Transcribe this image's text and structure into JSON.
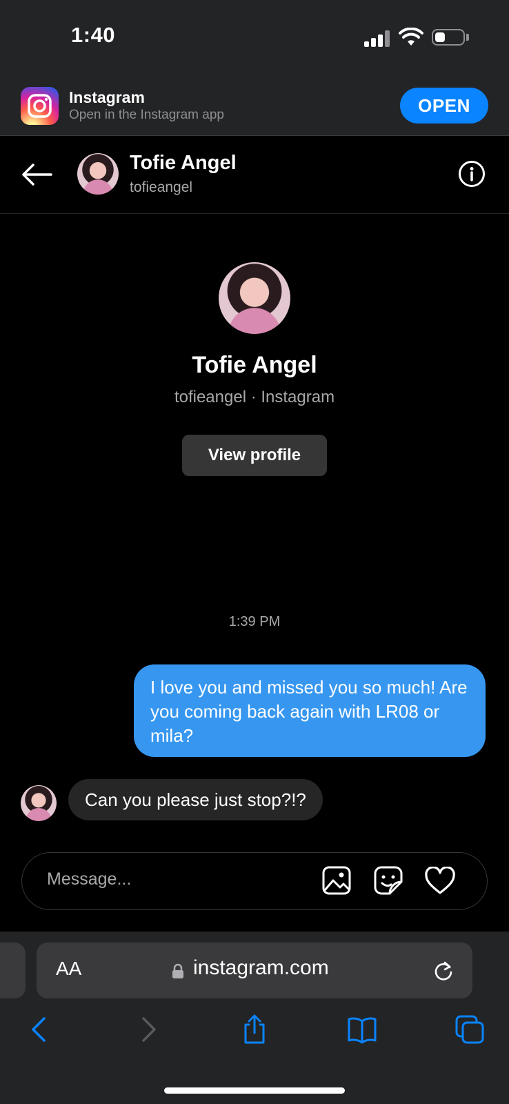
{
  "status_bar": {
    "time": "1:40"
  },
  "app_banner": {
    "title": "Instagram",
    "subtitle": "Open in the Instagram app",
    "open_label": "OPEN",
    "icon": "instagram-logo"
  },
  "chat_header": {
    "name": "Tofie Angel",
    "username": "tofieangel"
  },
  "profile_card": {
    "name": "Tofie Angel",
    "subtitle": "tofieangel · Instagram",
    "view_profile_label": "View profile"
  },
  "messages": {
    "timestamp": "1:39 PM",
    "items": [
      {
        "direction": "outgoing",
        "text": "I love you and missed you so much! Are you coming back again with LR08 or mila?"
      },
      {
        "direction": "incoming",
        "text": "Can you please just stop?!?"
      }
    ]
  },
  "composer": {
    "placeholder": "Message...",
    "icons": [
      "gallery-icon",
      "sticker-icon",
      "heart-icon"
    ]
  },
  "safari": {
    "text_size_label": "AA",
    "url": "instagram.com",
    "toolbar": [
      "back-icon",
      "forward-icon",
      "share-icon",
      "bookmarks-icon",
      "tabs-icon"
    ]
  },
  "colors": {
    "accent_blue": "#0a84ff",
    "outgoing_bubble": "#3797f0",
    "incoming_bubble": "#262626",
    "safari_chrome": "#232426",
    "disabled_icon": "#5a5a5e"
  }
}
